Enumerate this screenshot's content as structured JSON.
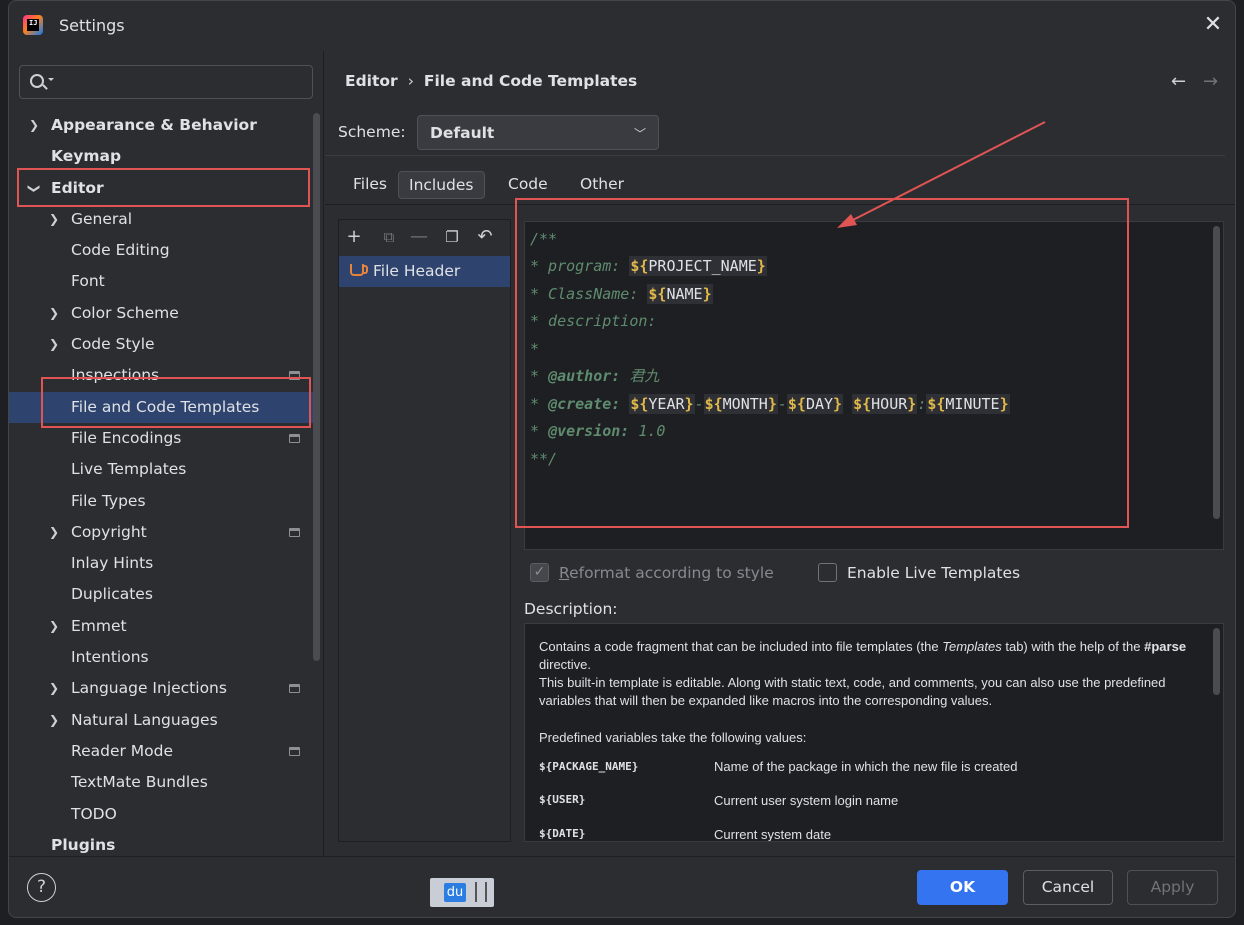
{
  "window": {
    "title": "Settings"
  },
  "search": {
    "placeholder": ""
  },
  "sidebar": {
    "items": [
      {
        "label": "Appearance & Behavior"
      },
      {
        "label": "Keymap"
      },
      {
        "label": "Editor"
      },
      {
        "label": "General"
      },
      {
        "label": "Code Editing"
      },
      {
        "label": "Font"
      },
      {
        "label": "Color Scheme"
      },
      {
        "label": "Code Style"
      },
      {
        "label": "Inspections"
      },
      {
        "label": "File and Code Templates"
      },
      {
        "label": "File Encodings"
      },
      {
        "label": "Live Templates"
      },
      {
        "label": "File Types"
      },
      {
        "label": "Copyright"
      },
      {
        "label": "Inlay Hints"
      },
      {
        "label": "Duplicates"
      },
      {
        "label": "Emmet"
      },
      {
        "label": "Intentions"
      },
      {
        "label": "Language Injections"
      },
      {
        "label": "Natural Languages"
      },
      {
        "label": "Reader Mode"
      },
      {
        "label": "TextMate Bundles"
      },
      {
        "label": "TODO"
      },
      {
        "label": "Plugins"
      }
    ]
  },
  "breadcrumb": {
    "parent": "Editor",
    "current": "File and Code Templates"
  },
  "scheme": {
    "label": "Scheme:",
    "value": "Default"
  },
  "tabs": [
    {
      "label": "Files"
    },
    {
      "label": "Includes"
    },
    {
      "label": "Code"
    },
    {
      "label": "Other"
    }
  ],
  "templates": {
    "items": [
      {
        "label": "File Header"
      }
    ]
  },
  "editor": {
    "lines": {
      "l1": "/**",
      "l2_prefix": "* program: ",
      "l2_var": "PROJECT_NAME",
      "l3_prefix": "* ClassName: ",
      "l3_var": "NAME",
      "l4": "* description:",
      "l5": "*",
      "l6_prefix": "* ",
      "l6_tag": "@author:",
      "l6_value": " 君九",
      "l7_prefix": "* ",
      "l7_tag": "@create:",
      "l7_v1": "YEAR",
      "l7_s1": "-",
      "l7_v2": "MONTH",
      "l7_s2": "-",
      "l7_v3": "DAY",
      "l7_s3": " ",
      "l7_v4": "HOUR",
      "l7_s4": ":",
      "l7_v5": "MINUTE",
      "l8_prefix": "* ",
      "l8_tag": "@version:",
      "l8_value": " 1.0",
      "l9": "**/"
    }
  },
  "options": {
    "reformat_pre": "R",
    "reformat_rest": "eformat according to style",
    "live_templates": "Enable Live Templates"
  },
  "description": {
    "title": "Description:",
    "p1a": "Contains a code fragment that can be included into file templates (the ",
    "p1b": "Templates",
    "p1c": " tab) with the help of the ",
    "p1d": "#parse",
    "p1e": " directive.",
    "p2": "This built-in template is editable. Along with static text, code, and comments, you can also use the predefined variables that will then be expanded like macros into the corresponding values.",
    "p3": "Predefined variables take the following values:",
    "vars": [
      {
        "name": "${PACKAGE_NAME}",
        "desc": "Name of the package in which the new file is created"
      },
      {
        "name": "${USER}",
        "desc": "Current user system login name"
      },
      {
        "name": "${DATE}",
        "desc": "Current system date"
      }
    ]
  },
  "footer": {
    "badge": "du",
    "ok": "OK",
    "cancel": "Cancel",
    "apply": "Apply"
  },
  "colors": {
    "accent": "#3574f0",
    "highlight_box": "#e05454",
    "selection": "#2e436e"
  }
}
